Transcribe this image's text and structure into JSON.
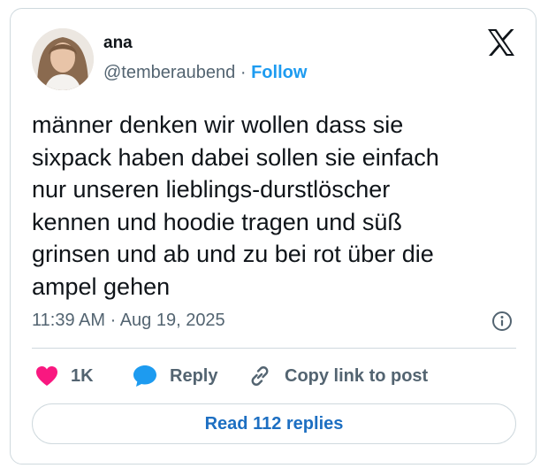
{
  "author": {
    "name": "ana",
    "handle": "@temberaubend",
    "separator": "·",
    "follow_label": "Follow"
  },
  "brand": {
    "logo_icon": "x-logo-icon"
  },
  "tweet": {
    "text": "männer denken wir wollen dass sie\nsixpack haben dabei sollen sie einfach\nnur unseren lieblings-durstlöscher\nkennen und hoodie tragen und süß\ngrinsen und ab und zu bei rot über die\nampel gehen",
    "timestamp": "11:39 AM · Aug 19, 2025"
  },
  "actions": {
    "like_count": "1K",
    "reply_label": "Reply",
    "copy_link_label": "Copy link to post",
    "read_replies_label": "Read 112 replies"
  },
  "colors": {
    "like": "#f91880",
    "reply": "#1d9bf0",
    "follow": "#1d9bf0",
    "read_replies": "#1d6fc2",
    "secondary_text": "#536471",
    "border": "#cfd9de"
  }
}
